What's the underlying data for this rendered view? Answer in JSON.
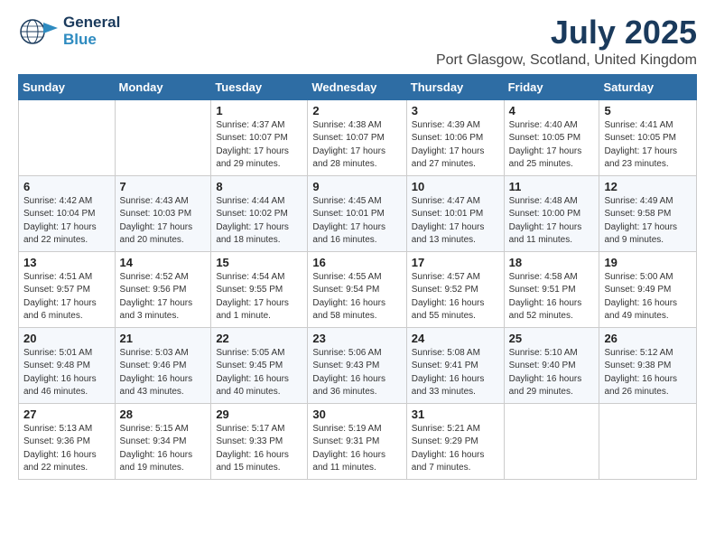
{
  "header": {
    "logo_general": "General",
    "logo_blue": "Blue",
    "month_year": "July 2025",
    "location": "Port Glasgow, Scotland, United Kingdom"
  },
  "weekdays": [
    "Sunday",
    "Monday",
    "Tuesday",
    "Wednesday",
    "Thursday",
    "Friday",
    "Saturday"
  ],
  "weeks": [
    [
      {
        "day": "",
        "info": ""
      },
      {
        "day": "",
        "info": ""
      },
      {
        "day": "1",
        "info": "Sunrise: 4:37 AM\nSunset: 10:07 PM\nDaylight: 17 hours\nand 29 minutes."
      },
      {
        "day": "2",
        "info": "Sunrise: 4:38 AM\nSunset: 10:07 PM\nDaylight: 17 hours\nand 28 minutes."
      },
      {
        "day": "3",
        "info": "Sunrise: 4:39 AM\nSunset: 10:06 PM\nDaylight: 17 hours\nand 27 minutes."
      },
      {
        "day": "4",
        "info": "Sunrise: 4:40 AM\nSunset: 10:05 PM\nDaylight: 17 hours\nand 25 minutes."
      },
      {
        "day": "5",
        "info": "Sunrise: 4:41 AM\nSunset: 10:05 PM\nDaylight: 17 hours\nand 23 minutes."
      }
    ],
    [
      {
        "day": "6",
        "info": "Sunrise: 4:42 AM\nSunset: 10:04 PM\nDaylight: 17 hours\nand 22 minutes."
      },
      {
        "day": "7",
        "info": "Sunrise: 4:43 AM\nSunset: 10:03 PM\nDaylight: 17 hours\nand 20 minutes."
      },
      {
        "day": "8",
        "info": "Sunrise: 4:44 AM\nSunset: 10:02 PM\nDaylight: 17 hours\nand 18 minutes."
      },
      {
        "day": "9",
        "info": "Sunrise: 4:45 AM\nSunset: 10:01 PM\nDaylight: 17 hours\nand 16 minutes."
      },
      {
        "day": "10",
        "info": "Sunrise: 4:47 AM\nSunset: 10:01 PM\nDaylight: 17 hours\nand 13 minutes."
      },
      {
        "day": "11",
        "info": "Sunrise: 4:48 AM\nSunset: 10:00 PM\nDaylight: 17 hours\nand 11 minutes."
      },
      {
        "day": "12",
        "info": "Sunrise: 4:49 AM\nSunset: 9:58 PM\nDaylight: 17 hours\nand 9 minutes."
      }
    ],
    [
      {
        "day": "13",
        "info": "Sunrise: 4:51 AM\nSunset: 9:57 PM\nDaylight: 17 hours\nand 6 minutes."
      },
      {
        "day": "14",
        "info": "Sunrise: 4:52 AM\nSunset: 9:56 PM\nDaylight: 17 hours\nand 3 minutes."
      },
      {
        "day": "15",
        "info": "Sunrise: 4:54 AM\nSunset: 9:55 PM\nDaylight: 17 hours\nand 1 minute."
      },
      {
        "day": "16",
        "info": "Sunrise: 4:55 AM\nSunset: 9:54 PM\nDaylight: 16 hours\nand 58 minutes."
      },
      {
        "day": "17",
        "info": "Sunrise: 4:57 AM\nSunset: 9:52 PM\nDaylight: 16 hours\nand 55 minutes."
      },
      {
        "day": "18",
        "info": "Sunrise: 4:58 AM\nSunset: 9:51 PM\nDaylight: 16 hours\nand 52 minutes."
      },
      {
        "day": "19",
        "info": "Sunrise: 5:00 AM\nSunset: 9:49 PM\nDaylight: 16 hours\nand 49 minutes."
      }
    ],
    [
      {
        "day": "20",
        "info": "Sunrise: 5:01 AM\nSunset: 9:48 PM\nDaylight: 16 hours\nand 46 minutes."
      },
      {
        "day": "21",
        "info": "Sunrise: 5:03 AM\nSunset: 9:46 PM\nDaylight: 16 hours\nand 43 minutes."
      },
      {
        "day": "22",
        "info": "Sunrise: 5:05 AM\nSunset: 9:45 PM\nDaylight: 16 hours\nand 40 minutes."
      },
      {
        "day": "23",
        "info": "Sunrise: 5:06 AM\nSunset: 9:43 PM\nDaylight: 16 hours\nand 36 minutes."
      },
      {
        "day": "24",
        "info": "Sunrise: 5:08 AM\nSunset: 9:41 PM\nDaylight: 16 hours\nand 33 minutes."
      },
      {
        "day": "25",
        "info": "Sunrise: 5:10 AM\nSunset: 9:40 PM\nDaylight: 16 hours\nand 29 minutes."
      },
      {
        "day": "26",
        "info": "Sunrise: 5:12 AM\nSunset: 9:38 PM\nDaylight: 16 hours\nand 26 minutes."
      }
    ],
    [
      {
        "day": "27",
        "info": "Sunrise: 5:13 AM\nSunset: 9:36 PM\nDaylight: 16 hours\nand 22 minutes."
      },
      {
        "day": "28",
        "info": "Sunrise: 5:15 AM\nSunset: 9:34 PM\nDaylight: 16 hours\nand 19 minutes."
      },
      {
        "day": "29",
        "info": "Sunrise: 5:17 AM\nSunset: 9:33 PM\nDaylight: 16 hours\nand 15 minutes."
      },
      {
        "day": "30",
        "info": "Sunrise: 5:19 AM\nSunset: 9:31 PM\nDaylight: 16 hours\nand 11 minutes."
      },
      {
        "day": "31",
        "info": "Sunrise: 5:21 AM\nSunset: 9:29 PM\nDaylight: 16 hours\nand 7 minutes."
      },
      {
        "day": "",
        "info": ""
      },
      {
        "day": "",
        "info": ""
      }
    ]
  ]
}
